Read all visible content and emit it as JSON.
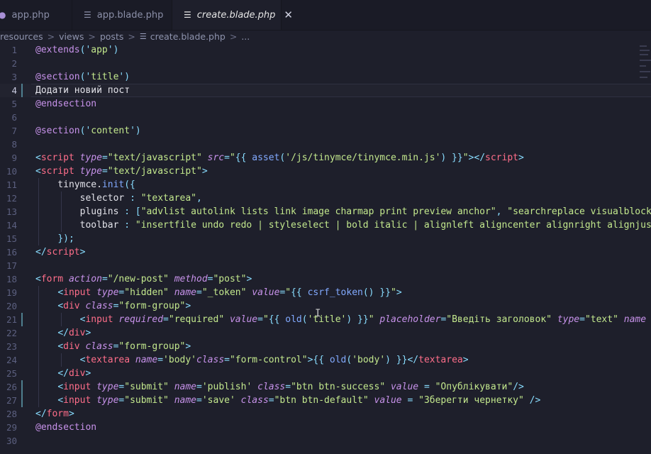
{
  "tabs": [
    {
      "label": "app.php",
      "icon": "elephant-icon",
      "active": false
    },
    {
      "label": "app.blade.php",
      "icon": "file-lines-icon",
      "active": false
    },
    {
      "label": "create.blade.php",
      "icon": "file-lines-icon",
      "active": true
    }
  ],
  "close_glyph": "✕",
  "breadcrumb": {
    "parts": [
      "resources",
      "views",
      "posts",
      "create.blade.php",
      "..."
    ],
    "separator": ">"
  },
  "editor": {
    "current_line": 4,
    "line_numbers": [
      "1",
      "2",
      "3",
      "4",
      "5",
      "6",
      "7",
      "8",
      "9",
      "10",
      "11",
      "12",
      "13",
      "14",
      "15",
      "16",
      "17",
      "18",
      "19",
      "20",
      "21",
      "22",
      "23",
      "24",
      "25",
      "26",
      "27",
      "28",
      "29",
      "30"
    ],
    "lines": [
      [
        [
          "kw",
          "@extends"
        ],
        [
          "br",
          "('"
        ],
        [
          "str",
          "app"
        ],
        [
          "br",
          "')"
        ]
      ],
      [],
      [
        [
          "kw",
          "@section"
        ],
        [
          "br",
          "('"
        ],
        [
          "str",
          "title"
        ],
        [
          "br",
          "')"
        ]
      ],
      [
        [
          "txt",
          "Додати новий пост"
        ]
      ],
      [
        [
          "kw",
          "@endsection"
        ]
      ],
      [],
      [
        [
          "kw",
          "@section"
        ],
        [
          "br",
          "('"
        ],
        [
          "str",
          "content"
        ],
        [
          "br",
          "')"
        ]
      ],
      [],
      [
        [
          "br",
          "<"
        ],
        [
          "tag",
          "script"
        ],
        [
          "txt",
          " "
        ],
        [
          "attr",
          "type"
        ],
        [
          "br",
          "="
        ],
        [
          "str",
          "\"text/javascript\""
        ],
        [
          "txt",
          " "
        ],
        [
          "attr",
          "src"
        ],
        [
          "br",
          "="
        ],
        [
          "str",
          "\""
        ],
        [
          "br",
          "{{ "
        ],
        [
          "fn",
          "asset"
        ],
        [
          "br",
          "("
        ],
        [
          "str",
          "'/js/tinymce/tinymce.min.js'"
        ],
        [
          "br",
          ") }}"
        ],
        [
          "str",
          "\""
        ],
        [
          "br",
          "></"
        ],
        [
          "tag",
          "script"
        ],
        [
          "br",
          ">"
        ]
      ],
      [
        [
          "br",
          "<"
        ],
        [
          "tag",
          "script"
        ],
        [
          "txt",
          " "
        ],
        [
          "attr",
          "type"
        ],
        [
          "br",
          "="
        ],
        [
          "str",
          "\"text/javascript\""
        ],
        [
          "br",
          ">"
        ]
      ],
      [
        [
          "txt",
          "    tinymce."
        ],
        [
          "fn",
          "init"
        ],
        [
          "br",
          "({"
        ]
      ],
      [
        [
          "txt",
          "        selector "
        ],
        [
          "br",
          ":"
        ],
        [
          "txt",
          " "
        ],
        [
          "str",
          "\"textarea\""
        ],
        [
          "br",
          ","
        ]
      ],
      [
        [
          "txt",
          "        plugins "
        ],
        [
          "br",
          ":"
        ],
        [
          "txt",
          " "
        ],
        [
          "br",
          "["
        ],
        [
          "str",
          "\"advlist autolink lists link image charmap print preview anchor\""
        ],
        [
          "br",
          ","
        ],
        [
          "txt",
          " "
        ],
        [
          "str",
          "\"searchreplace visualblock"
        ]
      ],
      [
        [
          "txt",
          "        toolbar "
        ],
        [
          "br",
          ":"
        ],
        [
          "txt",
          " "
        ],
        [
          "str",
          "\"insertfile undo redo | styleselect | bold italic | alignleft aligncenter alignright alignjus"
        ]
      ],
      [
        [
          "txt",
          "    "
        ],
        [
          "br",
          "});"
        ]
      ],
      [
        [
          "br",
          "</"
        ],
        [
          "tag",
          "script"
        ],
        [
          "br",
          ">"
        ]
      ],
      [],
      [
        [
          "br",
          "<"
        ],
        [
          "tag",
          "form"
        ],
        [
          "txt",
          " "
        ],
        [
          "attr",
          "action"
        ],
        [
          "br",
          "="
        ],
        [
          "str",
          "\"/new-post\""
        ],
        [
          "txt",
          " "
        ],
        [
          "attr",
          "method"
        ],
        [
          "br",
          "="
        ],
        [
          "str",
          "\"post\""
        ],
        [
          "br",
          ">"
        ]
      ],
      [
        [
          "txt",
          "    "
        ],
        [
          "br",
          "<"
        ],
        [
          "tag",
          "input"
        ],
        [
          "txt",
          " "
        ],
        [
          "attr",
          "type"
        ],
        [
          "br",
          "="
        ],
        [
          "str",
          "\"hidden\""
        ],
        [
          "txt",
          " "
        ],
        [
          "attr",
          "name"
        ],
        [
          "br",
          "="
        ],
        [
          "str",
          "\"_token\""
        ],
        [
          "txt",
          " "
        ],
        [
          "attr",
          "value"
        ],
        [
          "br",
          "="
        ],
        [
          "str",
          "\""
        ],
        [
          "br",
          "{{ "
        ],
        [
          "fn",
          "csrf_token"
        ],
        [
          "br",
          "() }}"
        ],
        [
          "str",
          "\""
        ],
        [
          "br",
          ">"
        ]
      ],
      [
        [
          "txt",
          "    "
        ],
        [
          "br",
          "<"
        ],
        [
          "tag",
          "div"
        ],
        [
          "txt",
          " "
        ],
        [
          "attr",
          "class"
        ],
        [
          "br",
          "="
        ],
        [
          "str",
          "\"form-group\""
        ],
        [
          "br",
          ">"
        ]
      ],
      [
        [
          "txt",
          "        "
        ],
        [
          "br",
          "<"
        ],
        [
          "tag",
          "input"
        ],
        [
          "txt",
          " "
        ],
        [
          "attr",
          "required"
        ],
        [
          "br",
          "="
        ],
        [
          "str",
          "\"required\""
        ],
        [
          "txt",
          " "
        ],
        [
          "attr",
          "value"
        ],
        [
          "br",
          "="
        ],
        [
          "str",
          "\""
        ],
        [
          "br",
          "{{ "
        ],
        [
          "fn",
          "old"
        ],
        [
          "br",
          "("
        ],
        [
          "str",
          "'title'"
        ],
        [
          "br",
          ") }}"
        ],
        [
          "str",
          "\""
        ],
        [
          "txt",
          " "
        ],
        [
          "attr",
          "placeholder"
        ],
        [
          "br",
          "="
        ],
        [
          "str",
          "\"Введіть заголовок\""
        ],
        [
          "txt",
          " "
        ],
        [
          "attr",
          "type"
        ],
        [
          "br",
          "="
        ],
        [
          "str",
          "\"text\""
        ],
        [
          "txt",
          " "
        ],
        [
          "attr",
          "name"
        ]
      ],
      [
        [
          "txt",
          "    "
        ],
        [
          "br",
          "</"
        ],
        [
          "tag",
          "div"
        ],
        [
          "br",
          ">"
        ]
      ],
      [
        [
          "txt",
          "    "
        ],
        [
          "br",
          "<"
        ],
        [
          "tag",
          "div"
        ],
        [
          "txt",
          " "
        ],
        [
          "attr",
          "class"
        ],
        [
          "br",
          "="
        ],
        [
          "str",
          "\"form-group\""
        ],
        [
          "br",
          ">"
        ]
      ],
      [
        [
          "txt",
          "        "
        ],
        [
          "br",
          "<"
        ],
        [
          "tag",
          "textarea"
        ],
        [
          "txt",
          " "
        ],
        [
          "attr",
          "name"
        ],
        [
          "br",
          "="
        ],
        [
          "str",
          "'body'"
        ],
        [
          "attr",
          "class"
        ],
        [
          "br",
          "="
        ],
        [
          "str",
          "\"form-control\""
        ],
        [
          "br",
          ">{{ "
        ],
        [
          "fn",
          "old"
        ],
        [
          "br",
          "("
        ],
        [
          "str",
          "'body'"
        ],
        [
          "br",
          ") }}</"
        ],
        [
          "tag",
          "textarea"
        ],
        [
          "br",
          ">"
        ]
      ],
      [
        [
          "txt",
          "    "
        ],
        [
          "br",
          "</"
        ],
        [
          "tag",
          "div"
        ],
        [
          "br",
          ">"
        ]
      ],
      [
        [
          "txt",
          "    "
        ],
        [
          "br",
          "<"
        ],
        [
          "tag",
          "input"
        ],
        [
          "txt",
          " "
        ],
        [
          "attr",
          "type"
        ],
        [
          "br",
          "="
        ],
        [
          "str",
          "\"submit\""
        ],
        [
          "txt",
          " "
        ],
        [
          "attr",
          "name"
        ],
        [
          "br",
          "="
        ],
        [
          "str",
          "'publish'"
        ],
        [
          "txt",
          " "
        ],
        [
          "attr",
          "class"
        ],
        [
          "br",
          "="
        ],
        [
          "str",
          "\"btn btn-success\""
        ],
        [
          "txt",
          " "
        ],
        [
          "attr",
          "value"
        ],
        [
          "txt",
          " "
        ],
        [
          "br",
          "="
        ],
        [
          "txt",
          " "
        ],
        [
          "str",
          "\"Опублікувати\""
        ],
        [
          "br",
          "/>"
        ]
      ],
      [
        [
          "txt",
          "    "
        ],
        [
          "br",
          "<"
        ],
        [
          "tag",
          "input"
        ],
        [
          "txt",
          " "
        ],
        [
          "attr",
          "type"
        ],
        [
          "br",
          "="
        ],
        [
          "str",
          "\"submit\""
        ],
        [
          "txt",
          " "
        ],
        [
          "attr",
          "name"
        ],
        [
          "br",
          "="
        ],
        [
          "str",
          "'save'"
        ],
        [
          "txt",
          " "
        ],
        [
          "attr",
          "class"
        ],
        [
          "br",
          "="
        ],
        [
          "str",
          "\"btn btn-default\""
        ],
        [
          "txt",
          " "
        ],
        [
          "attr",
          "value"
        ],
        [
          "txt",
          " "
        ],
        [
          "br",
          "="
        ],
        [
          "txt",
          " "
        ],
        [
          "str",
          "\"Зберегти чернетку\""
        ],
        [
          "txt",
          " "
        ],
        [
          "br",
          "/>"
        ]
      ],
      [
        [
          "br",
          "</"
        ],
        [
          "tag",
          "form"
        ],
        [
          "br",
          ">"
        ]
      ],
      [
        [
          "kw",
          "@endsection"
        ]
      ],
      []
    ],
    "modified_lines": [
      4,
      21,
      26,
      27
    ]
  },
  "colors": {
    "background": "#1e1f2b",
    "keyword": "#c792ea",
    "string": "#c3e88d",
    "tag": "#ff6e8a",
    "function": "#82aaff",
    "punctuation": "#89ddff"
  }
}
